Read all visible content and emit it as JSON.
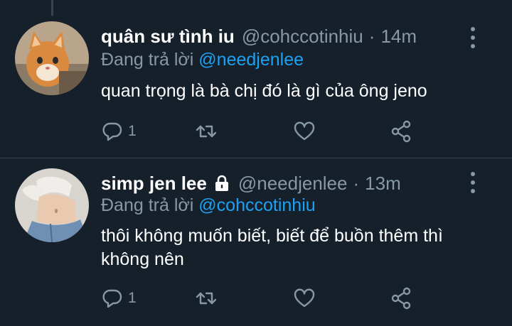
{
  "tweets": [
    {
      "display_name": "quân sư tình iu",
      "handle": "@cohccotinhiu",
      "separator": "·",
      "time": "14m",
      "reply_prefix": "Đang trả lời",
      "reply_to": "@needjenlee",
      "text": "quan trọng là bà chị đó là gì của ông jeno",
      "reply_count": "1",
      "avatar": "cat-photo",
      "locked": false
    },
    {
      "display_name": "simp jen lee",
      "handle": "@needjenlee",
      "separator": "·",
      "time": "13m",
      "reply_prefix": "Đang trả lời",
      "reply_to": "@cohccotinhiu",
      "text": "thôi không muốn biết, biết để buồn thêm thì không nên",
      "reply_count": "1",
      "avatar": "person-photo",
      "locked": true
    }
  ],
  "theme": {
    "background": "#15202b",
    "text_primary": "#ffffff",
    "text_secondary": "#8899a6",
    "accent": "#1da1f2",
    "divider": "#38444d"
  }
}
